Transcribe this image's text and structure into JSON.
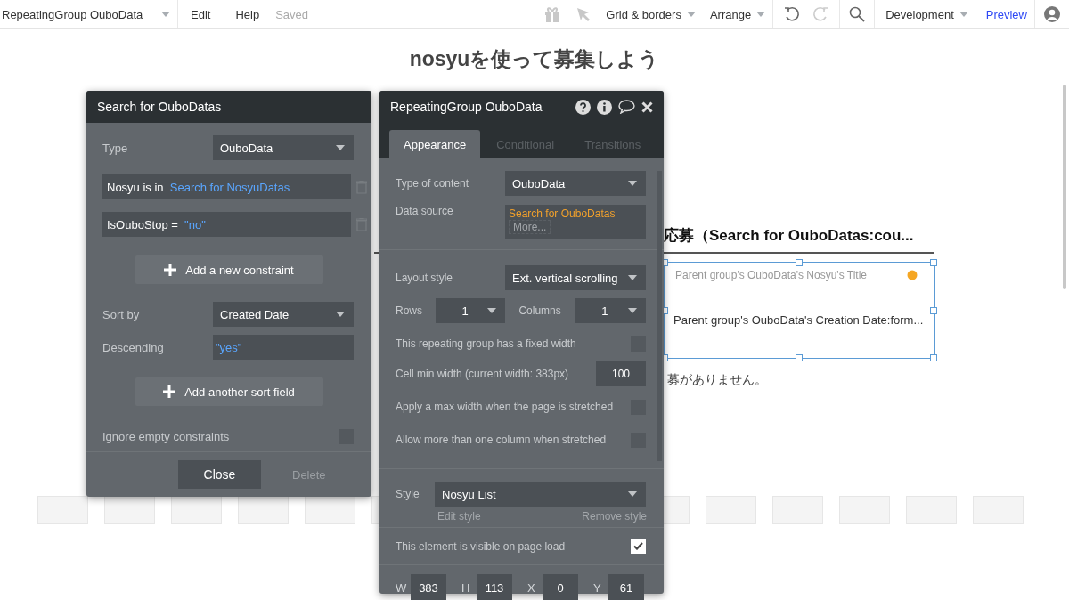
{
  "toolbar": {
    "element_selector": "RepeatingGroup OuboData",
    "menus": [
      "Edit",
      "Help"
    ],
    "status": "Saved",
    "grid_menu": "Grid & borders",
    "arrange_menu": "Arrange",
    "mode": "Development",
    "preview": "Preview"
  },
  "canvas": {
    "heading_lines": [
      "nosyuを使って募集しよう"
    ],
    "section_title": "応募（Search for OuboDatas:cou...",
    "cell_title": "Parent group's OuboData's Nosyu's Title",
    "cell_date": "Parent group's OuboData's Creation Date:form...",
    "empty_message": "募がありません。"
  },
  "search_panel": {
    "title": "Search for OuboDatas",
    "type": {
      "label": "Type",
      "value": "OuboData"
    },
    "constraints": [
      {
        "field": "Nosyu is in",
        "value": "Search for NosyuDatas"
      },
      {
        "field": "IsOuboStop =",
        "value": "\"no\""
      }
    ],
    "add_constraint": "Add a new constraint",
    "sort_by": {
      "label": "Sort by",
      "value": "Created Date"
    },
    "descending": {
      "label": "Descending",
      "value": "\"yes\""
    },
    "add_sort": "Add another sort field",
    "ignore_empty": {
      "label": "Ignore empty constraints",
      "checked": false
    },
    "close": "Close",
    "delete": {
      "label": "Delete",
      "disabled": true
    }
  },
  "property_panel": {
    "title": "RepeatingGroup OuboData",
    "tabs": [
      {
        "label": "Appearance",
        "selected": true
      },
      {
        "label": "Conditional",
        "selected": false
      },
      {
        "label": "Transitions",
        "selected": false
      }
    ],
    "type_of_content": {
      "label": "Type of content",
      "value": "OuboData"
    },
    "data_source": {
      "label": "Data source",
      "value": "Search for OuboDatas",
      "more": "More..."
    },
    "layout_style": {
      "label": "Layout style",
      "value": "Ext. vertical scrolling"
    },
    "rows": {
      "label": "Rows",
      "value": "1"
    },
    "columns": {
      "label": "Columns",
      "value": "1"
    },
    "settings": [
      {
        "kind": "check",
        "label": "This repeating group has a fixed width",
        "checked": false
      },
      {
        "kind": "number",
        "label": "Cell min width (current width: 383px)",
        "value": "100"
      },
      {
        "kind": "check",
        "label": "Apply a max width when the page is stretched",
        "checked": false
      },
      {
        "kind": "check",
        "label": "Allow more than one column when stretched",
        "checked": false
      }
    ],
    "style": {
      "label": "Style",
      "value": "Nosyu List",
      "edit": "Edit style",
      "remove": "Remove style"
    },
    "visible": {
      "label": "This element is visible on page load",
      "checked": true
    },
    "geometry": [
      {
        "label": "W",
        "value": "383"
      },
      {
        "label": "H",
        "value": "113"
      },
      {
        "label": "X",
        "value": "0"
      },
      {
        "label": "Y",
        "value": "61"
      }
    ]
  }
}
